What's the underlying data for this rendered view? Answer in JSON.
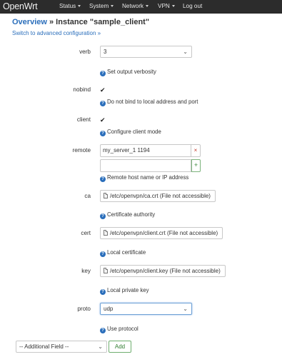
{
  "navbar": {
    "brand": "OpenWrt",
    "items": [
      "Status",
      "System",
      "Network",
      "VPN",
      "Log out"
    ]
  },
  "page": {
    "overview": "Overview",
    "separator": "»",
    "instance": "Instance \"sample_client\"",
    "switch_link": "Switch to advanced configuration »"
  },
  "fields": {
    "verb": {
      "label": "verb",
      "value": "3",
      "help": "Set output verbosity"
    },
    "nobind": {
      "label": "nobind",
      "check": "✔",
      "help": "Do not bind to local address and port"
    },
    "client": {
      "label": "client",
      "check": "✔",
      "help": "Configure client mode"
    },
    "remote": {
      "label": "remote",
      "value": "my_server_1 1194",
      "remove": "×",
      "add": "+",
      "help": "Remote host name or IP address"
    },
    "ca": {
      "label": "ca",
      "value": "/etc/openvpn/ca.crt (File not accessible)",
      "help": "Certificate authority"
    },
    "cert": {
      "label": "cert",
      "value": "/etc/openvpn/client.crt (File not accessible)",
      "help": "Local certificate"
    },
    "key": {
      "label": "key",
      "value": "/etc/openvpn/client.key (File not accessible)",
      "help": "Local private key"
    },
    "proto": {
      "label": "proto",
      "value": "udp",
      "help": "Use protocol"
    }
  },
  "footer": {
    "additional_field": "-- Additional Field --",
    "add_label": "Add"
  },
  "icons": {
    "help": "?",
    "dropdown": "⌄"
  },
  "colors": {
    "navbar_bg": "#2c2c2c",
    "link": "#2a6ebb",
    "add_green": "#2f7d2f",
    "remove_red": "#c0392b"
  }
}
